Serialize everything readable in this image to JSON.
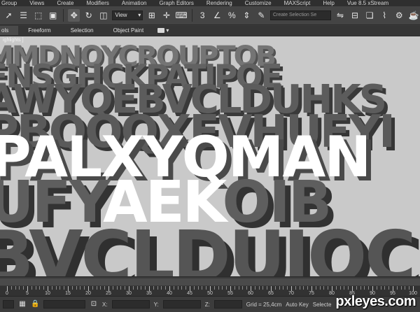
{
  "menu": {
    "items": [
      "Group",
      "Views",
      "Create",
      "Modifiers",
      "Animation",
      "Graph Editors",
      "Rendering",
      "Customize",
      "MAXScript",
      "Help",
      "Vue 8.5 xStream"
    ]
  },
  "toolbar": {
    "view_select": "View",
    "selection_set_placeholder": "Create Selection Se",
    "icons": [
      "select-icon",
      "select-name-icon",
      "rect-region-icon",
      "window-crossing-icon",
      "move-icon",
      "rotate-icon",
      "scale-icon",
      "snap-icon",
      "angle-snap-icon",
      "percent-snap-icon",
      "spinner-snap-icon",
      "mirror-icon",
      "align-icon",
      "layer-icon",
      "graph-icon",
      "render-setup-icon",
      "render-icon"
    ]
  },
  "ribbon": {
    "tabs": [
      "ols",
      "Freeform",
      "Selection",
      "Object Paint"
    ]
  },
  "viewport": {
    "label": "ighlights ]",
    "rows": [
      "MMDNOYCROUPTQB",
      "ENSGHCKPATIPOE",
      "AWYQEBVCLDUHKS",
      "PBQOQXEVHUFYI",
      "PALXYQMAN",
      "UFYAEKOIB",
      "BVCLDUIOC"
    ],
    "white_row6": "AEK"
  },
  "timeline": {
    "ticks": [
      "0",
      "5",
      "10",
      "15",
      "20",
      "25",
      "30",
      "35",
      "40",
      "45",
      "50",
      "55",
      "60",
      "65",
      "70",
      "75",
      "80",
      "85",
      "90",
      "95",
      "100"
    ]
  },
  "status": {
    "x_label": "X:",
    "y_label": "Y:",
    "z_label": "Z:",
    "grid": "Grid = 25,4cm",
    "auto_key": "Auto Key",
    "selected": "Selecte"
  },
  "watermark": "pxleyes.com",
  "colors": {
    "viewport_bg": "#c9c9c9",
    "letters_dark": "#5a5a5a",
    "letters_white": "#ffffff",
    "ui_bg": "#444444"
  }
}
